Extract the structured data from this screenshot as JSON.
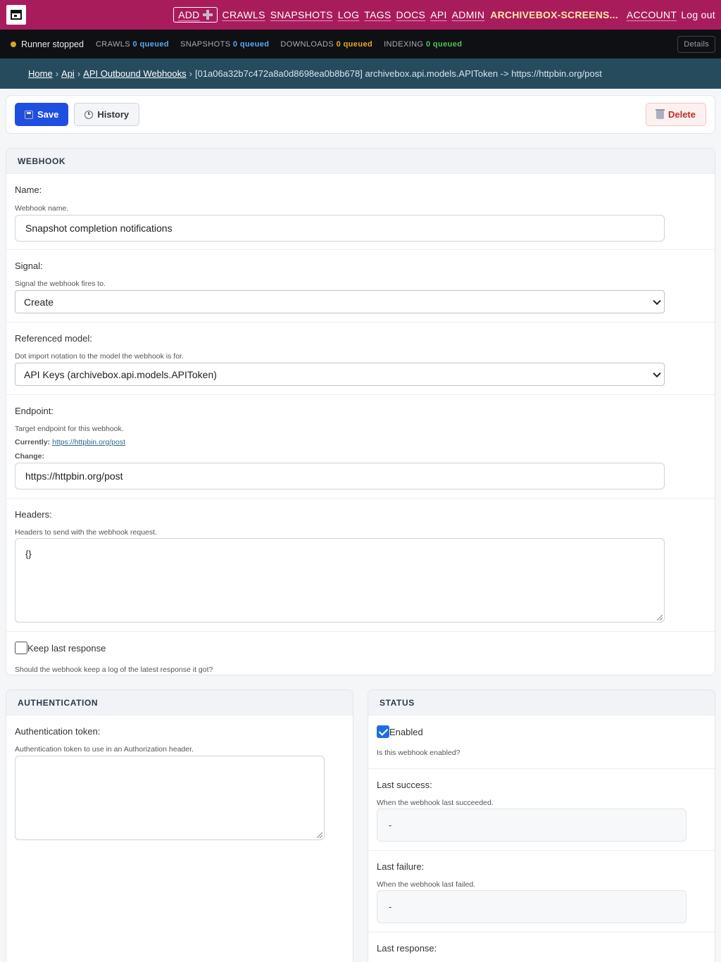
{
  "nav": {
    "add_label": "ADD",
    "items": [
      "CRAWLS",
      "SNAPSHOTS",
      "LOG",
      "TAGS",
      "DOCS",
      "API",
      "ADMIN"
    ],
    "brand": "ARCHIVEBOX-SCREENS...",
    "account": "ACCOUNT",
    "logout": "Log out"
  },
  "status": {
    "runner": "Runner stopped",
    "crawls_label": "CRAWLS",
    "crawls_value": "0 queued",
    "snapshots_label": "SNAPSHOTS",
    "snapshots_value": "0 queued",
    "downloads_label": "DOWNLOADS",
    "downloads_value": "0 queued",
    "indexing_label": "INDEXING",
    "indexing_value": "0 queued",
    "details_label": "Details",
    "colors": {
      "crawls": "#5ea8f0",
      "snapshots": "#5ea8f0",
      "downloads": "#e8a822",
      "indexing": "#4ec257",
      "runner_dot": "#d9a520"
    }
  },
  "breadcrumb": {
    "home": "Home",
    "api": "Api",
    "webhooks": "API Outbound Webhooks",
    "current": "[01a06a32b7c472a8a0d8698ea0b8b678] archivebox.api.models.APIToken -> https://httpbin.org/post"
  },
  "actions": {
    "save": "Save",
    "history": "History",
    "delete": "Delete"
  },
  "webhook": {
    "heading": "WEBHOOK",
    "name_label": "Name:",
    "name_help": "Webhook name.",
    "name_value": "Snapshot completion notifications",
    "signal_label": "Signal:",
    "signal_help": "Signal the webhook fires to.",
    "signal_value": "Create",
    "model_label": "Referenced model:",
    "model_help": "Dot import notation to the model the webhook is for.",
    "model_value": "API Keys (archivebox.api.models.APIToken)",
    "endpoint_label": "Endpoint:",
    "endpoint_help": "Target endpoint for this webhook.",
    "currently_label": "Currently:",
    "currently_link": "https://httpbin.org/post",
    "change_label": "Change:",
    "endpoint_value": "https://httpbin.org/post",
    "headers_label": "Headers:",
    "headers_help": "Headers to send with the webhook request.",
    "headers_value": "{}",
    "keep_label": "Keep last response",
    "keep_help": "Should the webhook keep a log of the latest response it got?"
  },
  "authentication": {
    "heading": "AUTHENTICATION",
    "token_label": "Authentication token:",
    "token_help": "Authentication token to use in an Authorization header.",
    "token_value": ""
  },
  "webhook_status": {
    "heading": "STATUS",
    "enabled_label": "Enabled",
    "enabled_help": "Is this webhook enabled?",
    "last_success_label": "Last success:",
    "last_success_help": "When the webhook last succeeded.",
    "last_success_value": "-",
    "last_failure_label": "Last failure:",
    "last_failure_help": "When the webhook last failed.",
    "last_failure_value": "-",
    "last_response_label": "Last response:"
  }
}
